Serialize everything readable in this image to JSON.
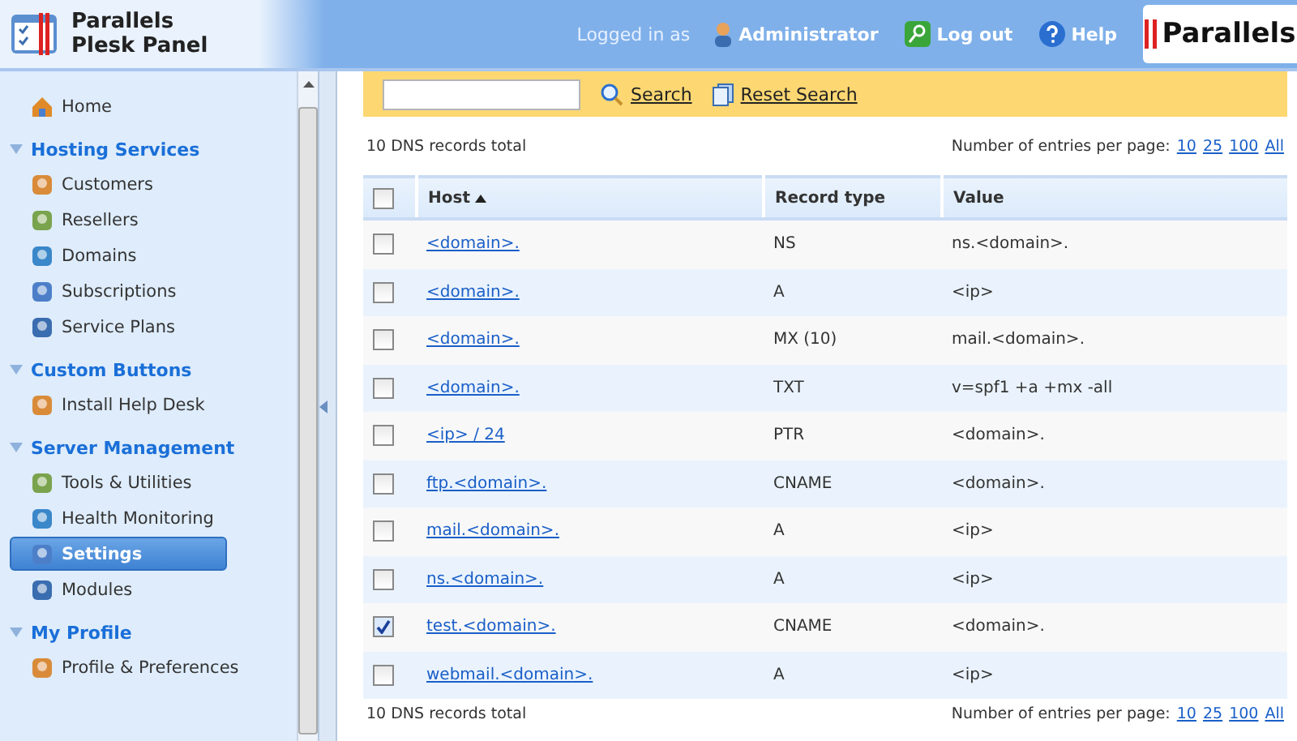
{
  "header": {
    "product": [
      "Parallels",
      "Plesk Panel"
    ],
    "logged_in_label": "Logged in as",
    "user": "Administrator",
    "logout": "Log out",
    "help": "Help",
    "brand": "Parallels"
  },
  "sidebar": {
    "home": "Home",
    "sections": [
      {
        "title": "Hosting Services",
        "expanded": true,
        "items": [
          {
            "label": "Customers",
            "selected": false
          },
          {
            "label": "Resellers",
            "selected": false
          },
          {
            "label": "Domains",
            "selected": false
          },
          {
            "label": "Subscriptions",
            "selected": false
          },
          {
            "label": "Service Plans",
            "selected": false
          }
        ]
      },
      {
        "title": "Custom Buttons",
        "expanded": true,
        "items": [
          {
            "label": "Install Help Desk",
            "selected": false
          }
        ]
      },
      {
        "title": "Server Management",
        "expanded": true,
        "items": [
          {
            "label": "Tools & Utilities",
            "selected": false
          },
          {
            "label": "Health Monitoring",
            "selected": false
          },
          {
            "label": "Settings",
            "selected": true
          },
          {
            "label": "Modules",
            "selected": false
          }
        ]
      },
      {
        "title": "My Profile",
        "expanded": true,
        "items": [
          {
            "label": "Profile & Preferences",
            "selected": false
          }
        ]
      }
    ]
  },
  "search": {
    "search_button": "Search",
    "reset_button": "Reset Search"
  },
  "summary": {
    "total": "10 DNS records total",
    "per_page_label": "Number of entries per page:",
    "per_page_options": [
      "10",
      "25",
      "100",
      "All"
    ]
  },
  "table": {
    "all_checked": false,
    "columns": [
      "Host",
      "Record type",
      "Value"
    ],
    "rows": [
      {
        "host": "<domain>.",
        "type": "NS",
        "value": "ns.<domain>.",
        "checked": false
      },
      {
        "host": "<domain>.",
        "type": "A",
        "value": "<ip>",
        "checked": false
      },
      {
        "host": "<domain>.",
        "type": "MX (10)",
        "value": "mail.<domain>.",
        "checked": false
      },
      {
        "host": "<domain>.",
        "type": "TXT",
        "value": "v=spf1 +a +mx -all",
        "checked": false
      },
      {
        "host": "<ip> / 24",
        "type": "PTR",
        "value": "<domain>.",
        "checked": false
      },
      {
        "host": "ftp.<domain>.",
        "type": "CNAME",
        "value": "<domain>.",
        "checked": false
      },
      {
        "host": "mail.<domain>.",
        "type": "A",
        "value": "<ip>",
        "checked": false
      },
      {
        "host": "ns.<domain>.",
        "type": "A",
        "value": "<ip>",
        "checked": false
      },
      {
        "host": "test.<domain>.",
        "type": "CNAME",
        "value": "<domain>.",
        "checked": true
      },
      {
        "host": "webmail.<domain>.",
        "type": "A",
        "value": "<ip>",
        "checked": false
      }
    ]
  },
  "footer": {
    "total": "10 DNS records total",
    "per_page_label": "Number of entries per page:",
    "per_page_options": [
      "10",
      "25",
      "100",
      "All"
    ]
  }
}
